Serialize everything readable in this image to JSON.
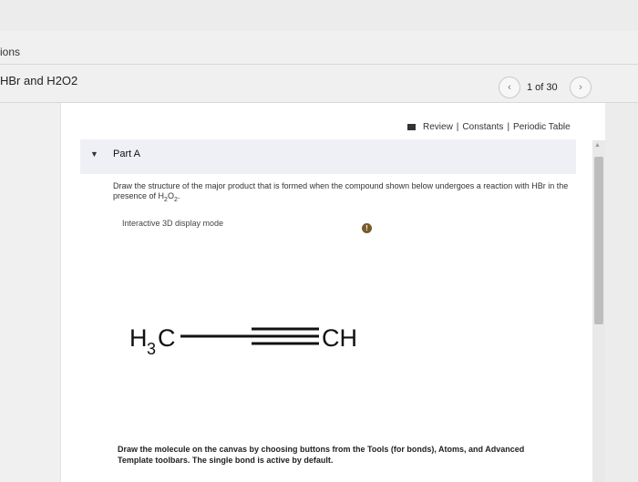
{
  "header": {
    "breadcrumb": "ions",
    "title": "HBr and H2O2",
    "prev_icon": "‹",
    "next_icon": "›",
    "page_count": "1 of 30"
  },
  "resources": {
    "icon": "resources-icon",
    "review": "Review",
    "sep1": "|",
    "constants": "Constants",
    "sep2": "|",
    "periodic_table": "Periodic Table"
  },
  "part": {
    "caret": "▼",
    "label": "Part A",
    "question_pre": "Draw the structure of the major product that is formed when the compound shown below undergoes a reaction with HBr in the presence of H",
    "sub1": "2",
    "mid": "O",
    "sub2": "2",
    "question_post": ".",
    "interactive_label": "Interactive 3D display mode",
    "info_icon": "!"
  },
  "molecule": {
    "left_h": "H",
    "left_sub": "3",
    "left_c": "C",
    "right_group": "CH",
    "bond_color": "#111111"
  },
  "instructions": "Draw the molecule on the canvas by choosing buttons from the Tools (for bonds), Atoms, and Advanced Template toolbars. The single bond is active by default."
}
